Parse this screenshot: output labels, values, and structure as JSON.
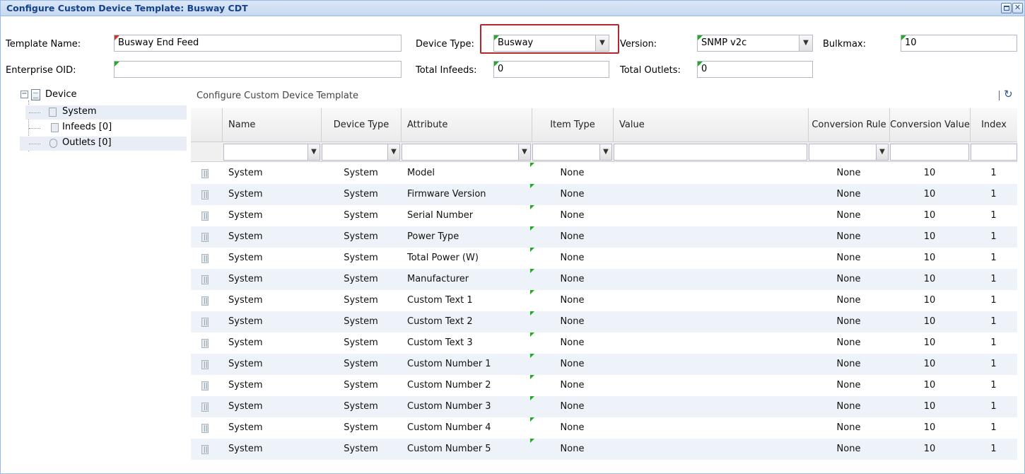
{
  "window": {
    "title": "Configure Custom Device Template: Busway CDT"
  },
  "form": {
    "template_name_label": "Template Name:",
    "template_name_value": "Busway End Feed",
    "enterprise_oid_label": "Enterprise OID:",
    "enterprise_oid_value": "",
    "device_type_label": "Device Type:",
    "device_type_value": "Busway",
    "total_infeeds_label": "Total Infeeds:",
    "total_infeeds_value": "0",
    "version_label": "Version:",
    "version_value": "SNMP v2c",
    "total_outlets_label": "Total Outlets:",
    "total_outlets_value": "0",
    "bulkmax_label": "Bulkmax:",
    "bulkmax_value": "10"
  },
  "tree": {
    "root": "Device",
    "items": [
      {
        "label": "System",
        "selected": true
      },
      {
        "label": "Infeeds [0]",
        "selected": false
      },
      {
        "label": "Outlets [0]",
        "selected": true
      }
    ]
  },
  "grid": {
    "panel_title": "Configure Custom Device Template",
    "columns": {
      "name": "Name",
      "device_type": "Device Type",
      "attribute": "Attribute",
      "item_type": "Item Type",
      "value": "Value",
      "conversion_rule": "Conversion Rule",
      "conversion_value": "Conversion Value",
      "index": "Index"
    },
    "rows": [
      {
        "name": "System",
        "device_type": "System",
        "attribute": "Model",
        "item_type": "None",
        "value": "",
        "conversion_rule": "None",
        "conversion_value": "10",
        "index": "1"
      },
      {
        "name": "System",
        "device_type": "System",
        "attribute": "Firmware Version",
        "item_type": "None",
        "value": "",
        "conversion_rule": "None",
        "conversion_value": "10",
        "index": "1"
      },
      {
        "name": "System",
        "device_type": "System",
        "attribute": "Serial Number",
        "item_type": "None",
        "value": "",
        "conversion_rule": "None",
        "conversion_value": "10",
        "index": "1"
      },
      {
        "name": "System",
        "device_type": "System",
        "attribute": "Power Type",
        "item_type": "None",
        "value": "",
        "conversion_rule": "None",
        "conversion_value": "10",
        "index": "1"
      },
      {
        "name": "System",
        "device_type": "System",
        "attribute": "Total Power (W)",
        "item_type": "None",
        "value": "",
        "conversion_rule": "None",
        "conversion_value": "10",
        "index": "1"
      },
      {
        "name": "System",
        "device_type": "System",
        "attribute": "Manufacturer",
        "item_type": "None",
        "value": "",
        "conversion_rule": "None",
        "conversion_value": "10",
        "index": "1"
      },
      {
        "name": "System",
        "device_type": "System",
        "attribute": "Custom Text 1",
        "item_type": "None",
        "value": "",
        "conversion_rule": "None",
        "conversion_value": "10",
        "index": "1"
      },
      {
        "name": "System",
        "device_type": "System",
        "attribute": "Custom Text 2",
        "item_type": "None",
        "value": "",
        "conversion_rule": "None",
        "conversion_value": "10",
        "index": "1"
      },
      {
        "name": "System",
        "device_type": "System",
        "attribute": "Custom Text 3",
        "item_type": "None",
        "value": "",
        "conversion_rule": "None",
        "conversion_value": "10",
        "index": "1"
      },
      {
        "name": "System",
        "device_type": "System",
        "attribute": "Custom Number 1",
        "item_type": "None",
        "value": "",
        "conversion_rule": "None",
        "conversion_value": "10",
        "index": "1"
      },
      {
        "name": "System",
        "device_type": "System",
        "attribute": "Custom Number 2",
        "item_type": "None",
        "value": "",
        "conversion_rule": "None",
        "conversion_value": "10",
        "index": "1"
      },
      {
        "name": "System",
        "device_type": "System",
        "attribute": "Custom Number 3",
        "item_type": "None",
        "value": "",
        "conversion_rule": "None",
        "conversion_value": "10",
        "index": "1"
      },
      {
        "name": "System",
        "device_type": "System",
        "attribute": "Custom Number 4",
        "item_type": "None",
        "value": "",
        "conversion_rule": "None",
        "conversion_value": "10",
        "index": "1"
      },
      {
        "name": "System",
        "device_type": "System",
        "attribute": "Custom Number 5",
        "item_type": "None",
        "value": "",
        "conversion_rule": "None",
        "conversion_value": "10",
        "index": "1"
      }
    ]
  },
  "colors": {
    "title_text": "#15428b",
    "highlight_border": "#b3262c",
    "dirty_green": "#22aa22",
    "dirty_red": "#c0392b",
    "alt_row": "#eef3fa"
  },
  "icons": [
    "restore-icon",
    "close-icon",
    "collapse-icon",
    "document-icon",
    "refresh-icon",
    "row-icon",
    "chevron-down-icon"
  ]
}
